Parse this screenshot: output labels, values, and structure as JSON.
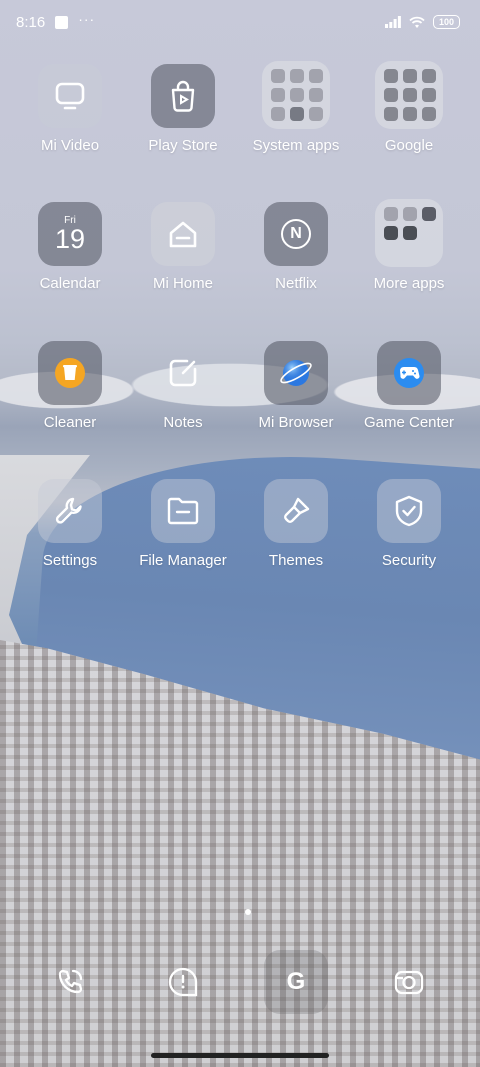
{
  "status_bar": {
    "time": "8:16",
    "notif_dots": "···",
    "battery": "100"
  },
  "apps": [
    {
      "label": "Mi Video",
      "icon": "tv-icon"
    },
    {
      "label": "Play Store",
      "icon": "play-bag-icon"
    },
    {
      "label": "System apps",
      "icon": "folder-icon"
    },
    {
      "label": "Google",
      "icon": "folder-icon"
    },
    {
      "label": "Calendar",
      "icon": "calendar-icon",
      "day": "Fri",
      "date": "19"
    },
    {
      "label": "Mi Home",
      "icon": "home-icon"
    },
    {
      "label": "Netflix",
      "icon": "netflix-n-icon",
      "glyph": "N"
    },
    {
      "label": "More apps",
      "icon": "folder-icon"
    },
    {
      "label": "Cleaner",
      "icon": "trash-icon"
    },
    {
      "label": "Notes",
      "icon": "note-pen-icon"
    },
    {
      "label": "Mi Browser",
      "icon": "planet-icon"
    },
    {
      "label": "Game Center",
      "icon": "gamepad-icon"
    },
    {
      "label": "Settings",
      "icon": "wrench-icon"
    },
    {
      "label": "File Manager",
      "icon": "folder-file-icon"
    },
    {
      "label": "Themes",
      "icon": "brush-icon"
    },
    {
      "label": "Security",
      "icon": "shield-check-icon"
    }
  ],
  "dock": [
    {
      "icon": "phone-icon"
    },
    {
      "icon": "chat-bubble-icon"
    },
    {
      "icon": "google-search-icon",
      "glyph": "G"
    },
    {
      "icon": "camera-icon"
    }
  ],
  "colors": {
    "cleaner_orange": "#f5a623",
    "browser_blue": "#2f7fe8",
    "game_blue": "#2b8cf0"
  }
}
